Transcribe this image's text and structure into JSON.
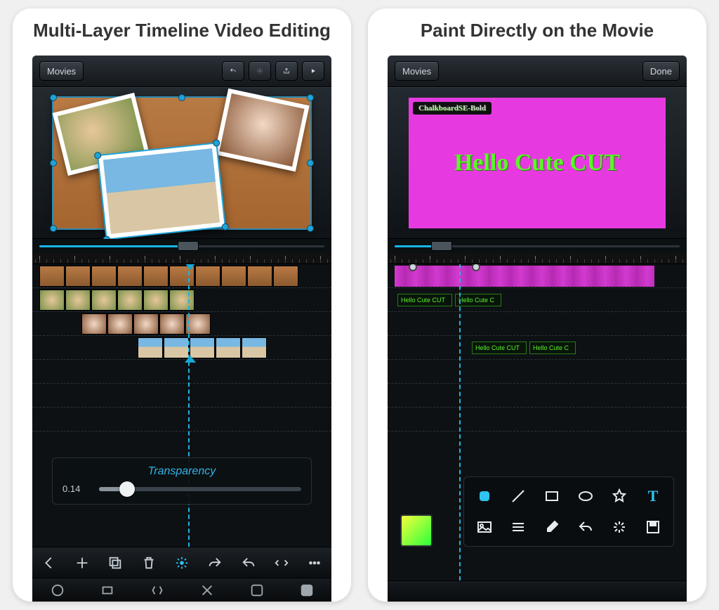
{
  "left": {
    "title": "Multi-Layer Timeline Video Editing",
    "topbar": {
      "movies": "Movies"
    },
    "seek": {
      "progressPct": 52
    },
    "panel": {
      "title": "Transparency",
      "value": "0.14",
      "pct": 14
    },
    "playheadPct": 52
  },
  "right": {
    "title": "Paint Directly on the Movie",
    "topbar": {
      "movies": "Movies",
      "done": "Done"
    },
    "fontLabel": "ChalkboardSE-Bold",
    "canvasText": "Hello Cute CUT",
    "seek": {
      "progressPct": 18
    },
    "clipLabels": {
      "a1": "Hello Cute CUT",
      "a2": "Hello Cute C",
      "b1": "Hello Cute CUT",
      "b2": "Hello Cute C"
    },
    "playheadPct": 24
  },
  "colors": {
    "accent": "#18b7e6",
    "pink": "#e63ae0",
    "green": "#5cf52a"
  }
}
